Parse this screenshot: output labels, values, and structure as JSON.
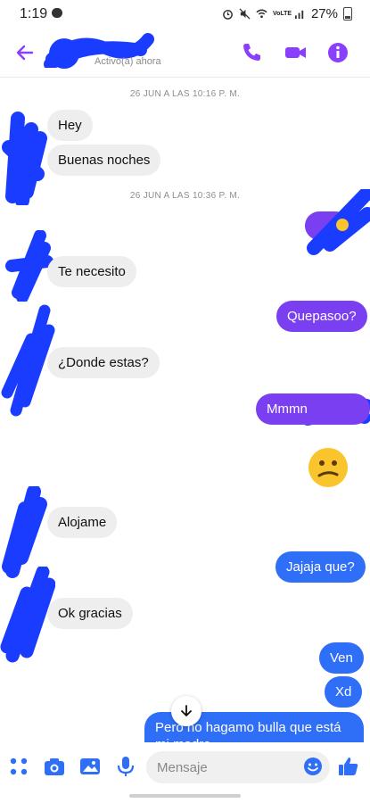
{
  "status_bar": {
    "time": "1:19",
    "battery": "27%",
    "network": "VoLTE"
  },
  "header": {
    "presence": "Activo(a) ahora"
  },
  "messages": {
    "date1": "26 JUN A LAS 10:16 P. M.",
    "date2": "26 JUN A LAS 10:36 P. M.",
    "m1": "Hey",
    "m2": "Buenas noches",
    "m3": "Te necesito",
    "m4": "Quepasoo?",
    "m5": "¿Donde estas?",
    "m6": "Mmmn",
    "m7": "Alojame",
    "m8": "Jajaja que?",
    "m9": "Ok gracias",
    "m10": "Ven",
    "m11": "Xd",
    "m12": "Pero no hagamo bulla que está mi madre"
  },
  "composer": {
    "placeholder": "Mensaje"
  },
  "colors": {
    "accent": "#7b3ff2",
    "blue": "#2f6ff7",
    "incoming": "#eeeeef",
    "scribble": "#1a3cff"
  },
  "icons": [
    "back-arrow-icon",
    "phone-icon",
    "video-icon",
    "info-icon",
    "apps-icon",
    "camera-icon",
    "gallery-icon",
    "mic-icon",
    "emoji-icon",
    "like-icon",
    "arrow-down-icon"
  ]
}
